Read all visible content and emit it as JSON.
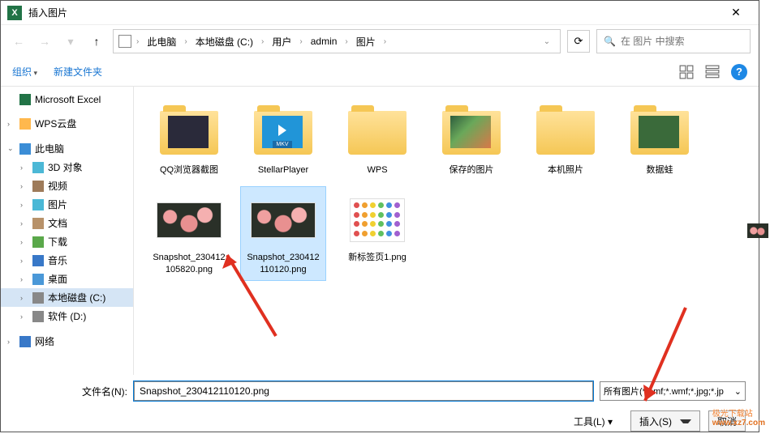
{
  "title": "插入图片",
  "breadcrumb": [
    "此电脑",
    "本地磁盘 (C:)",
    "用户",
    "admin",
    "图片"
  ],
  "search": {
    "placeholder": "在 图片 中搜索"
  },
  "toolbar": {
    "organize": "组织",
    "new_folder": "新建文件夹"
  },
  "sidebar": {
    "items": [
      {
        "label": "Microsoft Excel"
      },
      {
        "label": "WPS云盘"
      },
      {
        "label": "此电脑"
      },
      {
        "label": "3D 对象"
      },
      {
        "label": "视频"
      },
      {
        "label": "图片"
      },
      {
        "label": "文档"
      },
      {
        "label": "下载"
      },
      {
        "label": "音乐"
      },
      {
        "label": "桌面"
      },
      {
        "label": "本地磁盘 (C:)"
      },
      {
        "label": "软件 (D:)"
      },
      {
        "label": "网络"
      }
    ]
  },
  "files": [
    {
      "name": "QQ浏览器截图",
      "type": "folder",
      "variant": "dark"
    },
    {
      "name": "StellarPlayer",
      "type": "folder",
      "variant": "player"
    },
    {
      "name": "WPS",
      "type": "folder",
      "variant": "empty"
    },
    {
      "name": "保存的图片",
      "type": "folder",
      "variant": "colorful"
    },
    {
      "name": "本机照片",
      "type": "folder",
      "variant": "empty"
    },
    {
      "name": "数据蛙",
      "type": "folder",
      "variant": "frog"
    },
    {
      "name": "Snapshot_230412105820.png",
      "type": "image",
      "variant": "roses"
    },
    {
      "name": "Snapshot_230412110120.png",
      "type": "image",
      "variant": "roses",
      "selected": true
    },
    {
      "name": "新标签页1.png",
      "type": "image",
      "variant": "dots"
    }
  ],
  "bottom": {
    "filename_label": "文件名(N):",
    "filename_value": "Snapshot_230412110120.png",
    "filetype": "所有图片(*.emf;*.wmf;*.jpg;*.jp",
    "tools": "工具(L)",
    "insert": "插入(S)",
    "cancel": "取消"
  },
  "watermark": {
    "brand": "极光下载站",
    "site": "www.xz7.com"
  }
}
